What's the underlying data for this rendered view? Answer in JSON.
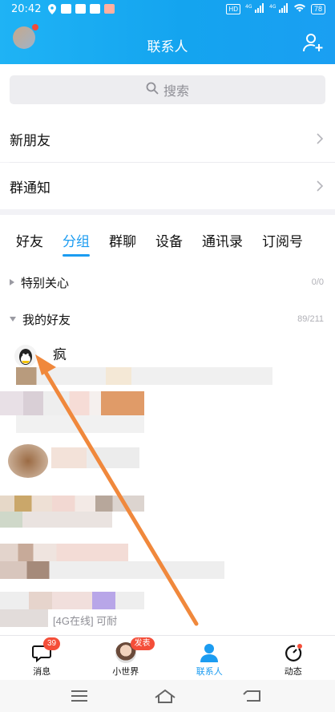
{
  "status": {
    "time": "20:42",
    "battery": "78",
    "network": "4G",
    "sim_label": "HD"
  },
  "header": {
    "title": "联系人"
  },
  "search": {
    "placeholder": "搜索"
  },
  "rows": [
    {
      "label": "新朋友"
    },
    {
      "label": "群通知"
    }
  ],
  "tabs": [
    {
      "label": "好友",
      "active": false
    },
    {
      "label": "分组",
      "active": true
    },
    {
      "label": "群聊",
      "active": false
    },
    {
      "label": "设备",
      "active": false
    },
    {
      "label": "通讯录",
      "active": false
    },
    {
      "label": "订阅号",
      "active": false
    }
  ],
  "groups": [
    {
      "name": "特别关心",
      "count": "0/0",
      "expanded": false
    },
    {
      "name": "我的好友",
      "count": "89/211",
      "expanded": true
    }
  ],
  "friends": [
    {
      "name": "疯"
    },
    {
      "name": ""
    },
    {
      "name": ""
    },
    {
      "name": ""
    },
    {
      "name": ""
    },
    {
      "name": ""
    }
  ],
  "last_status": "[4G在线] 可耐",
  "nav": [
    {
      "label": "消息",
      "badge": "39",
      "icon": "message-icon"
    },
    {
      "label": "小世界",
      "badge": "发表",
      "icon": "small-world-avatar"
    },
    {
      "label": "联系人",
      "badge": "",
      "icon": "contacts-icon",
      "active": true
    },
    {
      "label": "动态",
      "badge": "",
      "icon": "moments-icon"
    }
  ],
  "colors": {
    "accent": "#1b9cf1",
    "annotation_arrow": "#f0883c",
    "badge": "#f44e39"
  }
}
